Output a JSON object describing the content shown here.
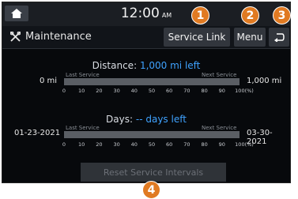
{
  "topbar": {
    "time": "12:00",
    "ampm": "AM"
  },
  "header": {
    "title": "Maintenance",
    "service_link_label": "Service Link",
    "menu_label": "Menu"
  },
  "distance": {
    "label": "Distance:",
    "value": "1,000 mi left",
    "start_value": "0 mi",
    "end_value": "1,000 mi",
    "last_service_label": "Last Service",
    "next_service_label": "Next Service",
    "progress_percent": 0
  },
  "days": {
    "label": "Days:",
    "value": "-- days left",
    "start_value": "01-23-2021",
    "end_value": "03-30-2021",
    "last_service_label": "Last Service",
    "next_service_label": "Next Service",
    "progress_percent": 0
  },
  "scale_ticks": [
    "0",
    "10",
    "20",
    "30",
    "40",
    "50",
    "60",
    "70",
    "80",
    "90",
    "100(%)"
  ],
  "reset_label": "Reset Service Intervals",
  "callouts": [
    "1",
    "2",
    "3",
    "4"
  ],
  "colors": {
    "accent": "#3fa2ff",
    "badge": "#e07a22",
    "background": "#07090c"
  },
  "icons": {
    "home": "home-icon",
    "wrench": "wrench-icon",
    "back": "back-icon"
  }
}
